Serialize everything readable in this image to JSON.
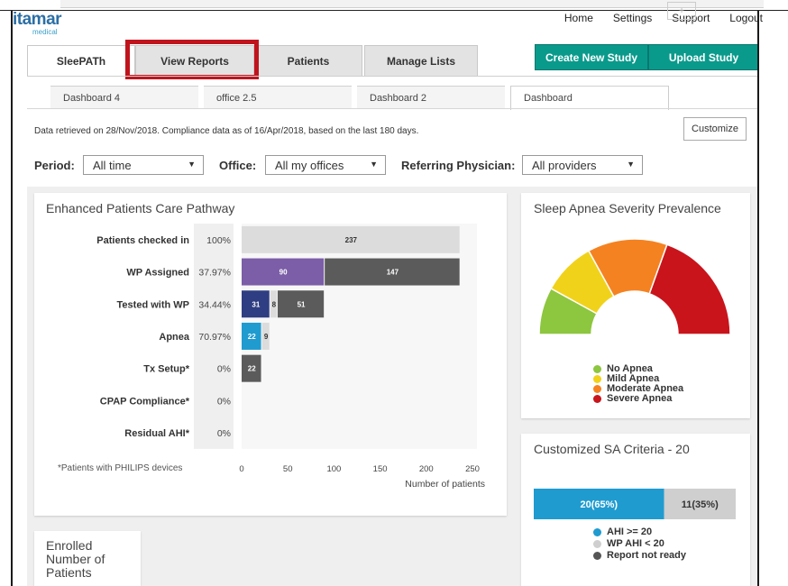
{
  "app": {
    "brand": "itamar",
    "brand_sub": "medical"
  },
  "topnav": [
    "Home",
    "Settings",
    "Support",
    "Logout"
  ],
  "main_tabs": [
    {
      "label": "SleePATh",
      "active": true
    },
    {
      "label": "View Reports",
      "active": false
    },
    {
      "label": "Patients",
      "active": false
    },
    {
      "label": "Manage Lists",
      "active": false
    }
  ],
  "actions": {
    "create_study": "Create New Study",
    "upload_study": "Upload Study"
  },
  "dashboard_tabs": [
    {
      "label": "Dashboard 4",
      "active": false
    },
    {
      "label": "office 2.5",
      "active": false
    },
    {
      "label": "Dashboard 2",
      "active": false
    },
    {
      "label": "Dashboard",
      "active": true
    }
  ],
  "add_tab": "+",
  "info": {
    "retrieved": "Data retrieved on 28/Nov/2018.  Compliance data as of 16/Apr/2018, based on the last 180 days.",
    "customize": "Customize"
  },
  "filters": {
    "period_label": "Period:",
    "period_value": "All time",
    "office_label": "Office:",
    "office_value": "All my offices",
    "physician_label": "Referring Physician:",
    "physician_value": "All providers"
  },
  "colors": {
    "accent_green": "#0a9a8c",
    "highlight_red": "#c0141d",
    "bar_gray": "#5b5b5b",
    "bar_light": "#dcdcdc",
    "bar_purple": "#7b5ea7",
    "bar_navy": "#2f3e82",
    "bar_blue": "#1f9bd0"
  },
  "pathway": {
    "title": "Enhanced Patients Care Pathway",
    "footnote": "*Patients with PHILIPS devices",
    "rows": [
      {
        "label": "Patients checked in",
        "pct": "100%"
      },
      {
        "label": "WP Assigned",
        "pct": "37.97%"
      },
      {
        "label": "Tested with WP",
        "pct": "34.44%"
      },
      {
        "label": "Apnea",
        "pct": "70.97%"
      },
      {
        "label": "Tx Setup*",
        "pct": "0%"
      },
      {
        "label": "CPAP Compliance*",
        "pct": "0%"
      },
      {
        "label": "Residual AHI*",
        "pct": "0%"
      }
    ]
  },
  "severity": {
    "title": "Sleep Apnea Severity Prevalence",
    "legend": [
      {
        "label": "No Apnea",
        "color": "#8dc63f"
      },
      {
        "label": "Mild Apnea",
        "color": "#f1d21a"
      },
      {
        "label": "Moderate Apnea",
        "color": "#f58220"
      },
      {
        "label": "Severe Apnea",
        "color": "#c9141c"
      }
    ]
  },
  "criteria": {
    "title": "Customized SA Criteria - 20",
    "legend": [
      {
        "label": "AHI >= 20",
        "color": "#1f9bd0"
      },
      {
        "label": "WP AHI < 20",
        "color": "#cfcfcf"
      },
      {
        "label": "Report not ready",
        "color": "#555555"
      }
    ]
  },
  "enrolled": {
    "title_line1": "Enrolled",
    "title_line2": "Number of",
    "title_line3": "Patients"
  },
  "chart_data": [
    {
      "type": "bar",
      "orientation": "horizontal",
      "stacked": true,
      "title": "Enhanced Patients Care Pathway",
      "xlabel": "Number of patients",
      "xlim": [
        0,
        250
      ],
      "xticks": [
        0,
        50,
        100,
        150,
        200,
        250
      ],
      "categories": [
        "Patients checked in",
        "WP Assigned",
        "Tested with WP",
        "Apnea",
        "Tx Setup*",
        "CPAP Compliance*",
        "Residual AHI*"
      ],
      "segments": [
        [
          {
            "value": 237,
            "color": "#dcdcdc",
            "label": "237",
            "label_color": "#333"
          }
        ],
        [
          {
            "value": 90,
            "color": "#7b5ea7",
            "label": "90",
            "label_color": "#fff"
          },
          {
            "value": 147,
            "color": "#5b5b5b",
            "label": "147",
            "label_color": "#fff"
          }
        ],
        [
          {
            "value": 31,
            "color": "#2f3e82",
            "label": "31",
            "label_color": "#fff"
          },
          {
            "value": 8,
            "color": "#dcdcdc",
            "label": "8",
            "label_color": "#333"
          },
          {
            "value": 51,
            "color": "#5b5b5b",
            "label": "51",
            "label_color": "#fff"
          }
        ],
        [
          {
            "value": 22,
            "color": "#1f9bd0",
            "label": "22",
            "label_color": "#fff"
          },
          {
            "value": 9,
            "color": "#dcdcdc",
            "label": "9",
            "label_color": "#333"
          }
        ],
        [
          {
            "value": 22,
            "color": "#5b5b5b",
            "label": "22",
            "label_color": "#fff"
          }
        ],
        [],
        []
      ]
    },
    {
      "type": "pie",
      "variant": "half-donut",
      "title": "Sleep Apnea Severity Prevalence",
      "labels": [
        "No Apnea",
        "Mild Apnea",
        "Moderate Apnea",
        "Severe Apnea"
      ],
      "values": [
        16,
        18,
        27,
        39
      ],
      "colors": [
        "#8dc63f",
        "#f1d21a",
        "#f58220",
        "#c9141c"
      ]
    },
    {
      "type": "bar",
      "orientation": "horizontal",
      "stacked": true,
      "title": "Customized SA Criteria - 20",
      "categories": [
        ""
      ],
      "segments": [
        {
          "name": "AHI >= 20",
          "value": 20,
          "label": "20(65%)",
          "color": "#1f9bd0",
          "label_color": "#fff"
        },
        {
          "name": "WP AHI < 20",
          "value": 11,
          "label": "11(35%)",
          "color": "#cfcfcf",
          "label_color": "#333"
        }
      ]
    }
  ]
}
